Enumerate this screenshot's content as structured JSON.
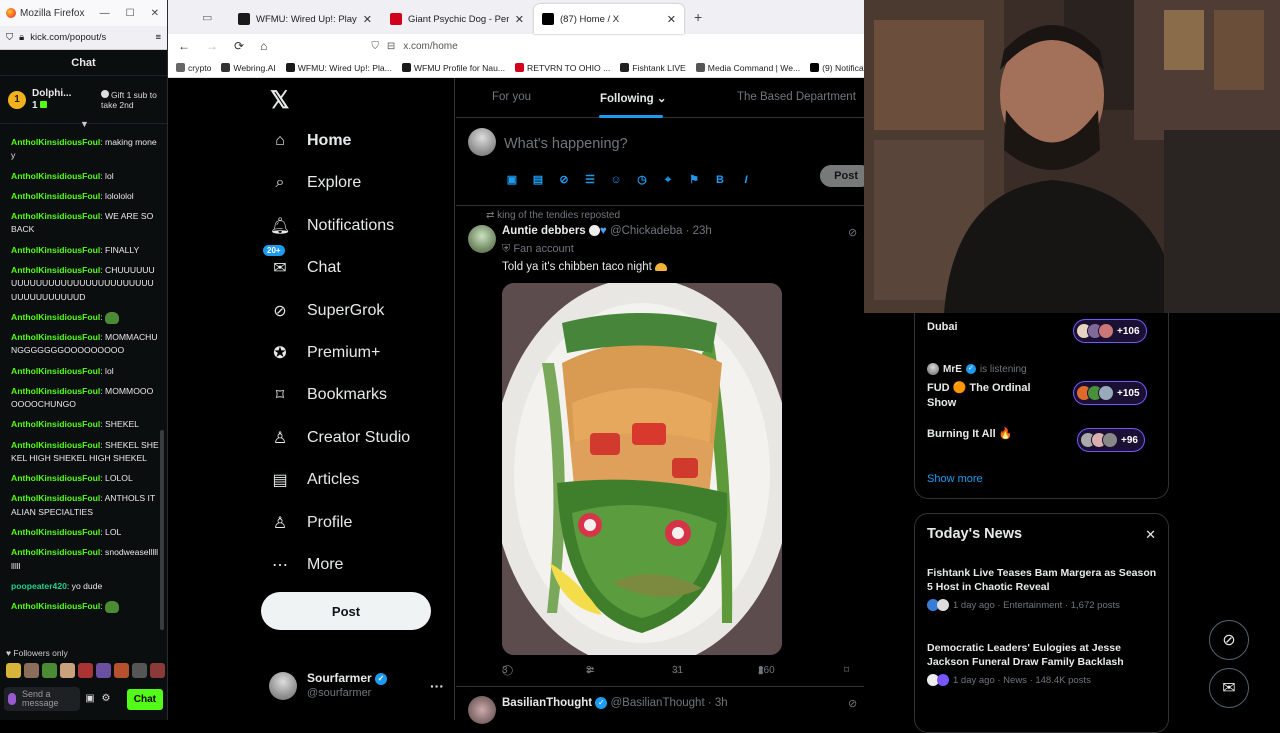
{
  "kick": {
    "window_title": "Mozilla Firefox",
    "url": "kick.com/popout/s",
    "chat_header": "Chat",
    "pinned": {
      "name": "Dolphi...",
      "count": "1",
      "gift_text": "Gift 1 sub to take 2nd"
    },
    "messages": [
      {
        "user": "AntholKinsidiousFoul",
        "text": "making money"
      },
      {
        "user": "AntholKinsidiousFoul",
        "text": "lol"
      },
      {
        "user": "AntholKinsidiousFoul",
        "text": "lolololol"
      },
      {
        "user": "AntholKinsidiousFoul",
        "text": "WE ARE SO BACK"
      },
      {
        "user": "AntholKinsidiousFoul",
        "text": "FINALLY"
      },
      {
        "user": "AntholKinsidiousFoul",
        "text": "CHUUUUUUUUUUUUUUUUUUUUUUUUUUUUUUUUUUUUUUUUD"
      },
      {
        "user": "AntholKinsidiousFoul",
        "text": ""
      },
      {
        "user": "AntholKinsidiousFoul",
        "text": "MOMMACHUNGGGGGGGOOOOOOOOO"
      },
      {
        "user": "AntholKinsidiousFoul",
        "text": "lol"
      },
      {
        "user": "AntholKinsidiousFoul",
        "text": "MOMMOOOOOOOCHUNGO"
      },
      {
        "user": "AntholKinsidiousFoul",
        "text": "SHEKEL"
      },
      {
        "user": "AntholKinsidiousFoul",
        "text": "SHEKEL SHEKEL HIGH SHEKEL HIGH SHEKEL"
      },
      {
        "user": "AntholKinsidiousFoul",
        "text": "LOLOL"
      },
      {
        "user": "AntholKinsidiousFoul",
        "text": "ANTHOLS ITALIAN SPECIALTIES"
      },
      {
        "user": "AntholKinsidiousFoul",
        "text": "LOL"
      },
      {
        "user": "AntholKinsidiousFoul",
        "text": "snodweasellllllllll"
      },
      {
        "user": "poopeater420",
        "text": "yo dude"
      },
      {
        "user": "AntholKinsidiousFoul",
        "text": ""
      }
    ],
    "followers_only": "Followers only",
    "send_placeholder": "Send a message",
    "chat_button": "Chat"
  },
  "browser": {
    "tabs": [
      {
        "label": "WFMU: Wired Up!: Playlist from",
        "icon_color": "#1a1a1a"
      },
      {
        "label": "Giant Psychic Dog - Perple",
        "icon_color": "#d0021b"
      },
      {
        "label": "(87) Home / X",
        "icon_color": "#000000"
      }
    ],
    "url": "x.com/home",
    "bookmarks": [
      {
        "label": "crypto",
        "color": "#666666"
      },
      {
        "label": "Webring.AI",
        "color": "#333333"
      },
      {
        "label": "WFMU: Wired Up!: Pla...",
        "color": "#1a1a1a"
      },
      {
        "label": "WFMU Profile for Nau...",
        "color": "#1a1a1a"
      },
      {
        "label": "RETVRN TO OHIO ...",
        "color": "#d0021b"
      },
      {
        "label": "Fishtank LIVE",
        "color": "#222222"
      },
      {
        "label": "Media Command | We...",
        "color": "#555555"
      },
      {
        "label": "(9) Notifications / X",
        "color": "#000000"
      }
    ]
  },
  "x": {
    "nav": [
      {
        "label": "Home",
        "icon": "home-icon"
      },
      {
        "label": "Explore",
        "icon": "search-icon"
      },
      {
        "label": "Notifications",
        "icon": "bell-icon"
      },
      {
        "label": "Chat",
        "icon": "mail-icon",
        "badge": "20+"
      },
      {
        "label": "SuperGrok",
        "icon": "grok-icon"
      },
      {
        "label": "Premium+",
        "icon": "verified-icon"
      },
      {
        "label": "Bookmarks",
        "icon": "bookmark-icon"
      },
      {
        "label": "Creator Studio",
        "icon": "creator-icon"
      },
      {
        "label": "Articles",
        "icon": "articles-icon"
      },
      {
        "label": "Profile",
        "icon": "person-icon"
      },
      {
        "label": "More",
        "icon": "more-icon"
      }
    ],
    "post_button": "Post",
    "account": {
      "name": "Sourfarmer",
      "handle": "@sourfarmer"
    },
    "timeline_tabs": [
      "For you",
      "Following",
      "The Based Department"
    ],
    "compose_placeholder": "What's happening?",
    "compose_post": "Post",
    "tweet": {
      "reposted_by": "king of the tendies reposted",
      "name": "Auntie debbers",
      "handle": "@Chickadeba",
      "time": "23h",
      "label": "Fan account",
      "text": "Told ya it's chibben taco night",
      "replies": "3",
      "reposts": "3",
      "likes": "31",
      "views": "260"
    },
    "tweet2": {
      "name": "BasilianThought",
      "handle": "@BasilianThought",
      "time": "3h"
    },
    "spaces": [
      {
        "title": "Dubai",
        "count": "+106"
      },
      {
        "title": "FUD 🟠 The Ordinal Show",
        "count": "+105"
      },
      {
        "title": "Burning It All 🔥",
        "count": "+96"
      }
    ],
    "listening": {
      "name": "MrE",
      "status": "is listening"
    },
    "show_more": "Show more",
    "news_title": "Today's News",
    "news": [
      {
        "headline": "Fishtank Live Teases Bam Margera as Season 5 Host in Chaotic Reveal",
        "meta": "1 day ago · Entertainment · 1,672 posts"
      },
      {
        "headline": "Democratic Leaders' Eulogies at Jesse Jackson Funeral Draw Family Backlash",
        "meta": "1 day ago · News · 148.4K posts"
      }
    ]
  }
}
